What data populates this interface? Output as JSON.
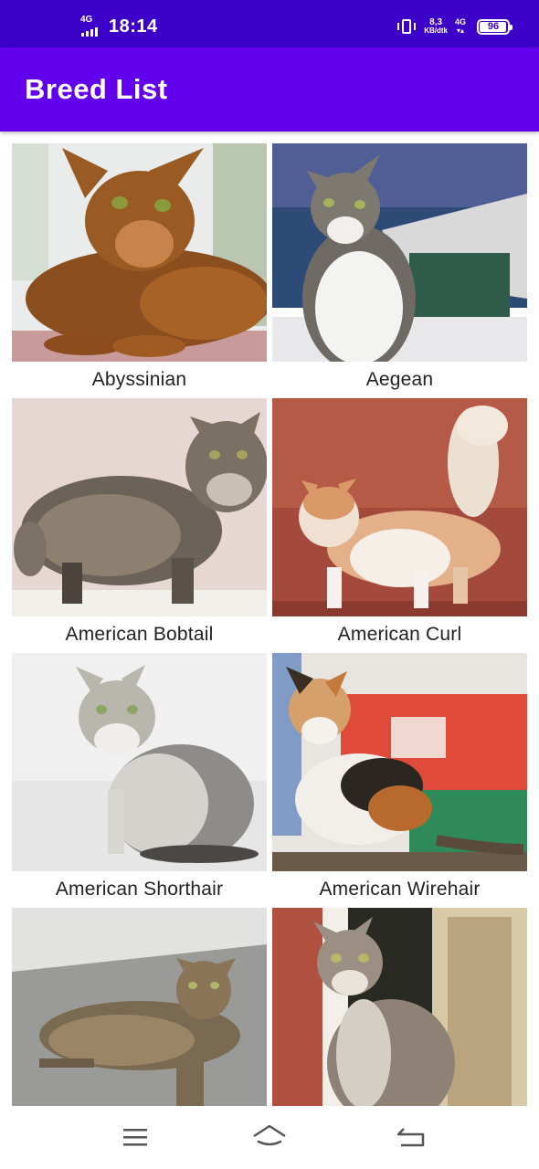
{
  "status_bar": {
    "network_left": "4G",
    "time": "18:14",
    "speed_value": "8,3",
    "speed_unit": "KB/dtk",
    "network_right": "4G",
    "battery": "96",
    "battery_level": 0.96
  },
  "app_bar": {
    "title": "Breed List"
  },
  "breeds": [
    {
      "name": "Abyssinian"
    },
    {
      "name": "Aegean"
    },
    {
      "name": "American Bobtail"
    },
    {
      "name": "American Curl"
    },
    {
      "name": "American Shorthair"
    },
    {
      "name": "American Wirehair"
    },
    {
      "name": ""
    },
    {
      "name": ""
    }
  ],
  "nav": {
    "menu_icon": "menu-icon",
    "home_icon": "home-icon",
    "back_icon": "back-icon"
  },
  "colors": {
    "status_bar": "#3d00c9",
    "app_bar": "#6200ee"
  }
}
